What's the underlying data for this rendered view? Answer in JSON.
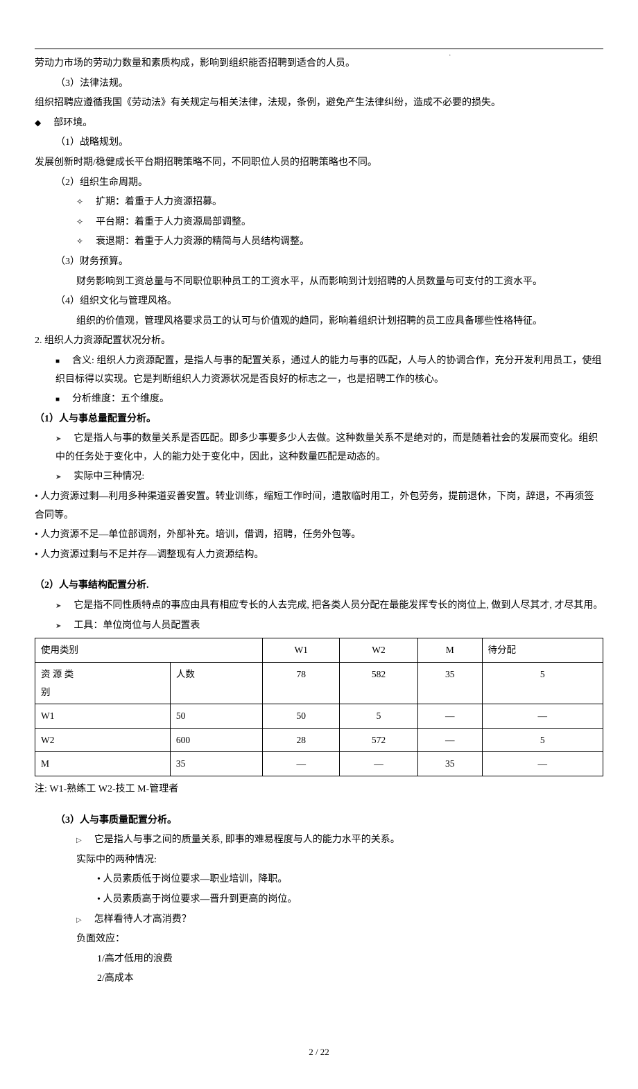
{
  "top_dot": ".",
  "body1": {
    "l1": "劳动力市场的劳动力数量和素质构成，影响到组织能否招聘到适合的人员。",
    "l2": "（3）法律法规。",
    "l3": "组织招聘应遵循我国《劳动法》有关规定与相关法律，法规，条例，避免产生法律纠纷，造成不必要的损失。",
    "l4": "部环境。",
    "l5": "（1）战略规划。",
    "l6": "发展创新时期/稳健成长平台期招聘策略不同，不同职位人员的招聘策略也不同。",
    "l7": "（2）组织生命周期。",
    "l8": "扩期：着重于人力资源招募。",
    "l9": "平台期：着重于人力资源局部调整。",
    "l10": "衰退期：着重于人力资源的精简与人员结构调整。",
    "l11": "（3）财务预算。",
    "l12": "财务影响到工资总量与不同职位职种员工的工资水平，从而影响到计划招聘的人员数量与可支付的工资水平。",
    "l13": "（4）组织文化与管理风格。",
    "l14": "组织的价值观，管理风格要求员工的认可与价值观的趋同，影响着组织计划招聘的员工应具备哪些性格特征。"
  },
  "body2": {
    "l1": "2. 组织人力资源配置状况分析。",
    "l2": "含义: 组织人力资源配置，是指人与事的配置关系，通过人的能力与事的匹配，人与人的协调合作，充分开发利用员工，使组织目标得以实现。它是判断组织人力资源状况是否良好的标志之一，也是招聘工作的核心。",
    "l3": "分析维度：五个维度。"
  },
  "sec_a": {
    "title": "（1）人与事总量配置分析。",
    "p1": "它是指人与事的数量关系是否匹配。即多少事要多少人去做。这种数量关系不是绝对的，而是随着社会的发展而变化。组织中的任务处于变化中，人的能力处于变化中，因此，这种数量匹配是动态的。",
    "p2": "实际中三种情况:",
    "b1": "• 人力资源过剩—利用多种渠道妥善安置。转业训练，缩短工作时间，遣散临时用工，外包劳务，提前退休，下岗，辞退，不再须签合同等。",
    "b2": "• 人力资源不足—单位部调剂，外部补充。培训，借调，招聘，任务外包等。",
    "b3": "• 人力资源过剩与不足并存—调整现有人力资源结构。"
  },
  "sec_b": {
    "title": "（2）人与事结构配置分析.",
    "p1": "它是指不同性质特点的事应由具有相应专长的人去完成, 把各类人员分配在最能发挥专长的岗位上, 做到人尽其才, 才尽其用。",
    "p2": "工具：单位岗位与人员配置表"
  },
  "table": {
    "hdr_use": "使用类别",
    "hdr_w1": "W1",
    "hdr_w2": "W2",
    "hdr_m": "M",
    "hdr_pd": "待分配",
    "row0_l1": "资 源 类",
    "row0_l2": "别",
    "row0_c2": "人数",
    "row0_v1": "78",
    "row0_v2": "582",
    "row0_v3": "35",
    "row0_v4": "5",
    "r1": {
      "c1": "W1",
      "c2": "50",
      "c3": "50",
      "c4": "5",
      "c5": "—",
      "c6": "—"
    },
    "r2": {
      "c1": "W2",
      "c2": "600",
      "c3": "28",
      "c4": "572",
      "c5": "—",
      "c6": "5"
    },
    "r3": {
      "c1": "M",
      "c2": "35",
      "c3": "—",
      "c4": "—",
      "c5": "35",
      "c6": "—"
    },
    "note": "注: W1-熟练工 W2-技工 M-管理者"
  },
  "sec_c": {
    "title": "（3）人与事质量配置分析。",
    "p1": "它是指人与事之间的质量关系, 即事的难易程度与人的能力水平的关系。",
    "p2": "实际中的两种情况:",
    "b1": "• 人员素质低于岗位要求—职业培训，降职。",
    "b2": "• 人员素质高于岗位要求—晋升到更高的岗位。",
    "q": "怎样看待人才高消费？",
    "neg": "负面效应：",
    "neg1": "1/高才低用的浪费",
    "neg2": "2/高成本"
  },
  "footer": "2 / 22",
  "chart_data": {
    "type": "table",
    "title": "单位岗位与人员配置表",
    "columns_top": [
      "使用类别",
      "W1",
      "W2",
      "M",
      "待分配"
    ],
    "row_header": {
      "label": "资源类别",
      "sublabel": "人数",
      "values": [
        78,
        582,
        35,
        5
      ]
    },
    "rows": [
      {
        "label": "W1",
        "count": 50,
        "W1": 50,
        "W2": 5,
        "M": null,
        "pending": null
      },
      {
        "label": "W2",
        "count": 600,
        "W1": 28,
        "W2": 572,
        "M": null,
        "pending": 5
      },
      {
        "label": "M",
        "count": 35,
        "W1": null,
        "W2": null,
        "M": 35,
        "pending": null
      }
    ],
    "note": "W1-熟练工 W2-技工 M-管理者"
  }
}
